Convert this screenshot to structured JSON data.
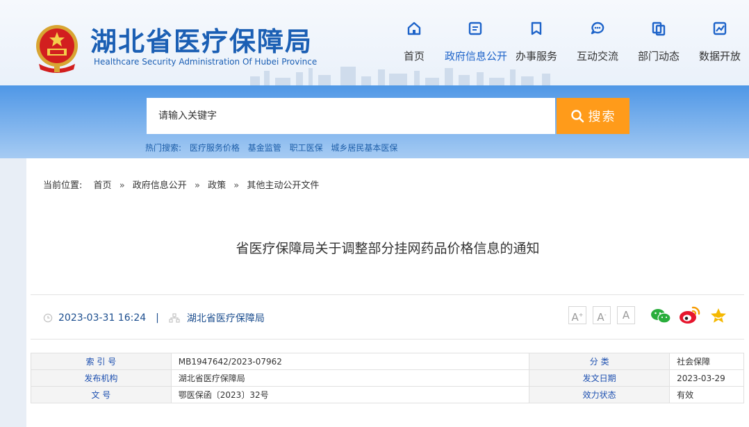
{
  "header": {
    "title": "湖北省医疗保障局",
    "subtitle": "Healthcare Security Administration Of Hubei Province"
  },
  "nav": [
    {
      "label": "首页",
      "icon": "home-icon",
      "active": false
    },
    {
      "label": "政府信息公开",
      "icon": "document-list-icon",
      "active": true
    },
    {
      "label": "办事服务",
      "icon": "bookmark-icon",
      "active": false
    },
    {
      "label": "互动交流",
      "icon": "chat-bubble-icon",
      "active": false
    },
    {
      "label": "部门动态",
      "icon": "copy-pages-icon",
      "active": false
    },
    {
      "label": "数据开放",
      "icon": "trend-chart-icon",
      "active": false
    }
  ],
  "search": {
    "placeholder": "请输入关键字",
    "button_label": "搜索",
    "hot_label": "热门搜索:",
    "hot_terms": [
      "医疗服务价格",
      "基金监管",
      "职工医保",
      "城乡居民基本医保"
    ]
  },
  "breadcrumb": {
    "label": "当前位置:",
    "items": [
      "首页",
      "政府信息公开",
      "政策",
      "其他主动公开文件"
    ],
    "separator": "»"
  },
  "article": {
    "title": "省医疗保障局关于调整部分挂网药品价格信息的通知",
    "datetime": "2023-03-31 16:24",
    "divider": "|",
    "source": "湖北省医疗保障局",
    "font_sizes": [
      "A",
      "A",
      "A"
    ]
  },
  "info_table": {
    "rows": [
      {
        "k1": "索 引 号",
        "v1": "MB1947642/2023-07962",
        "k2": "分    类",
        "v2": "社会保障"
      },
      {
        "k1": "发布机构",
        "v1": "湖北省医疗保障局",
        "k2": "发文日期",
        "v2": "2023-03-29"
      },
      {
        "k1": "文    号",
        "v1": "鄂医保函〔2023〕32号",
        "k2": "效力状态",
        "v2": "有效"
      }
    ]
  },
  "colors": {
    "brand_blue": "#1b5fb4",
    "nav_active": "#1d63c9",
    "search_button": "#ff9b1a",
    "wechat": "#2aae3c",
    "weibo": "#e6162d",
    "favorite": "#f5b800"
  }
}
